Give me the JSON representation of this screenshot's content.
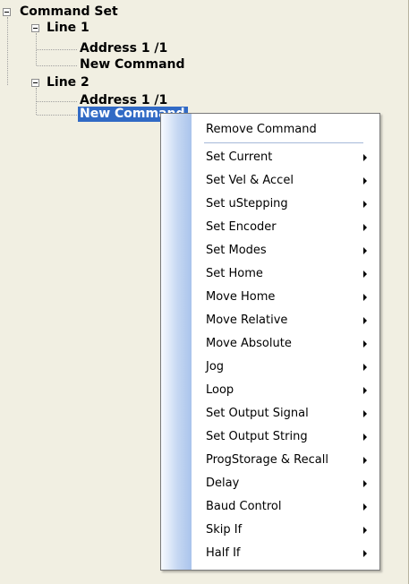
{
  "tree": {
    "root": {
      "label": "Command Set"
    },
    "lines": [
      {
        "label": "Line 1",
        "children": [
          "Address 1 /1",
          "New Command"
        ]
      },
      {
        "label": "Line 2",
        "children": [
          "Address 1 /1",
          "New Command"
        ]
      }
    ]
  },
  "context_menu": {
    "items": [
      {
        "label": "Remove Command",
        "submenu": false
      },
      {
        "label": "Set Current",
        "submenu": true
      },
      {
        "label": "Set Vel & Accel",
        "submenu": true
      },
      {
        "label": "Set uStepping",
        "submenu": true
      },
      {
        "label": "Set Encoder",
        "submenu": true
      },
      {
        "label": "Set Modes",
        "submenu": true
      },
      {
        "label": "Set Home",
        "submenu": true
      },
      {
        "label": "Move Home",
        "submenu": true
      },
      {
        "label": "Move Relative",
        "submenu": true
      },
      {
        "label": "Move Absolute",
        "submenu": true
      },
      {
        "label": "Jog",
        "submenu": true
      },
      {
        "label": "Loop",
        "submenu": true
      },
      {
        "label": "Set Output Signal",
        "submenu": true
      },
      {
        "label": "Set Output String",
        "submenu": true
      },
      {
        "label": "ProgStorage & Recall",
        "submenu": true
      },
      {
        "label": "Delay",
        "submenu": true
      },
      {
        "label": "Baud Control",
        "submenu": true
      },
      {
        "label": "Skip If",
        "submenu": true
      },
      {
        "label": "Half If",
        "submenu": true
      }
    ]
  },
  "colors": {
    "selection": "#316ac5",
    "panel_bg": "#f1efe2"
  }
}
